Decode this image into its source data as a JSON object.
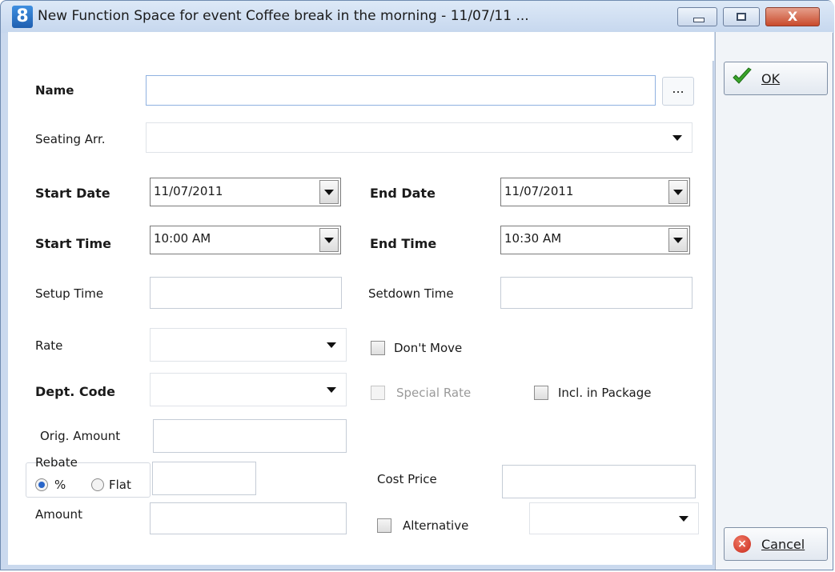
{
  "window": {
    "app_icon_text": "8",
    "title": "New Function Space for event Coffee break in the morning - 11/07/11 ...",
    "close_glyph": "X"
  },
  "form": {
    "name": {
      "label": "Name",
      "value": "",
      "ellipsis": "..."
    },
    "seating_arr": {
      "label": "Seating Arr.",
      "value": ""
    },
    "start_date": {
      "label": "Start Date",
      "value": "11/07/2011"
    },
    "end_date": {
      "label": "End Date",
      "value": "11/07/2011"
    },
    "start_time": {
      "label": "Start Time",
      "value": "10:00 AM"
    },
    "end_time": {
      "label": "End Time",
      "value": "10:30 AM"
    },
    "setup_time": {
      "label": "Setup Time",
      "value": ""
    },
    "setdown_time": {
      "label": "Setdown Time",
      "value": ""
    },
    "rate": {
      "label": "Rate",
      "value": ""
    },
    "dont_move": {
      "label": "Don't Move",
      "checked": false
    },
    "dept_code": {
      "label": "Dept. Code",
      "value": ""
    },
    "special_rate": {
      "label": "Special Rate",
      "checked": false,
      "enabled": false
    },
    "incl_in_package": {
      "label": "Incl. in Package",
      "checked": false
    },
    "orig_amount": {
      "label": "Orig. Amount",
      "value": ""
    },
    "rebate": {
      "label": "Rebate",
      "value": "",
      "options": [
        {
          "label": "%",
          "selected": true
        },
        {
          "label": "Flat",
          "selected": false
        }
      ]
    },
    "cost_price": {
      "label": "Cost Price",
      "value": ""
    },
    "amount": {
      "label": "Amount",
      "value": ""
    },
    "alternative": {
      "label": "Alternative",
      "checked": false,
      "value": ""
    }
  },
  "actions": {
    "ok_label": "OK",
    "cancel_label": "Cancel"
  },
  "colors": {
    "window_frame": "#cad9ee",
    "title_gradient_top": "#dde9f7",
    "close_button": "#c94a2c",
    "ok_check": "#3aa52a",
    "cancel_icon": "#c8281a"
  }
}
